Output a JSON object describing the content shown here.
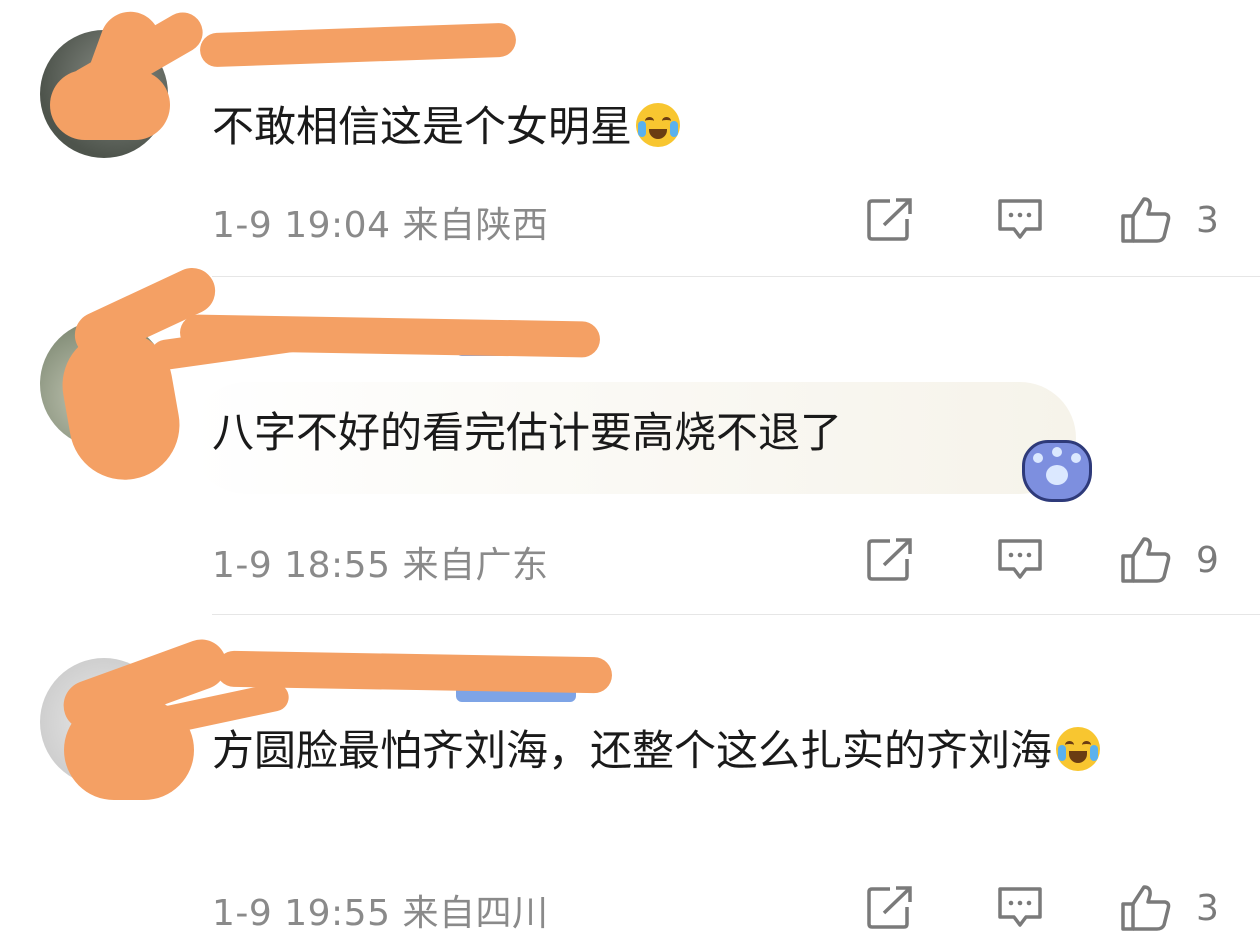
{
  "comments": [
    {
      "text": "不敢相信这是个女明星",
      "emoji": "crying-face-emoji",
      "time": "1-9 19:04",
      "location": "来自陕西",
      "likes": "3"
    },
    {
      "text": "八字不好的看完估计要高烧不退了",
      "emoji": "paw-sticker",
      "time": "1-9 18:55",
      "location": "来自广东",
      "likes": "9"
    },
    {
      "text": "方圆脸最怕齐刘海，还整个这么扎实的齐刘海",
      "emoji": "laughing-tears-emoji",
      "time": "1-9 19:55",
      "location": "来自四川",
      "likes": "3"
    }
  ],
  "icons": {
    "share": "share-icon",
    "reply": "comment-icon",
    "like": "thumbs-up-icon"
  },
  "colors": {
    "redaction": "#f4a064",
    "meta_text": "#8a8a8a",
    "divider": "#e6e6e6"
  }
}
